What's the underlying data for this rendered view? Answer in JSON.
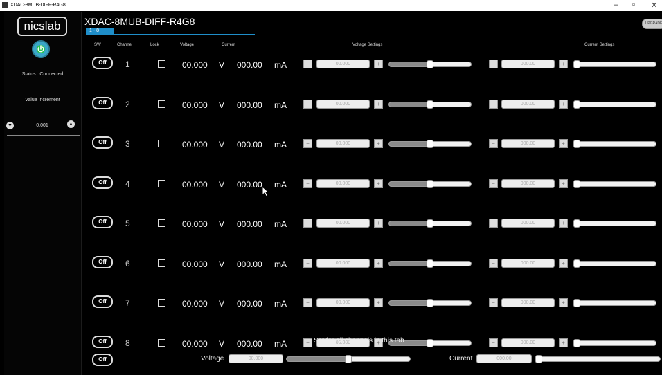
{
  "window": {
    "title": "XDAC-8MUB-DIFF-R4G8",
    "minimize": "–",
    "maximize": "▫",
    "close": "✕"
  },
  "sidebar": {
    "logo": "nicslab",
    "status": "Status : Connected",
    "value_increment_label": "Value Increment",
    "value_increment": "0.001"
  },
  "header": {
    "device_title": "XDAC-8MUB-DIFF-R4G8",
    "tab": "1 - 8",
    "upgrade": "UPGRADE",
    "columns": {
      "sw": "SW",
      "channel": "Channel",
      "lock": "Lock",
      "voltage": "Voltage",
      "current": "Current",
      "voltage_settings": "Voltage Settings",
      "current_settings": "Current Settings"
    }
  },
  "channels": [
    {
      "sw": "Off",
      "channel": "1",
      "voltage": "00.000",
      "voltage_unit": "V",
      "current": "000.00",
      "current_unit": "mA",
      "voltage_set": "00.000",
      "current_set": "000.00"
    },
    {
      "sw": "Off",
      "channel": "2",
      "voltage": "00.000",
      "voltage_unit": "V",
      "current": "000.00",
      "current_unit": "mA",
      "voltage_set": "00.000",
      "current_set": "000.00"
    },
    {
      "sw": "Off",
      "channel": "3",
      "voltage": "00.000",
      "voltage_unit": "V",
      "current": "000.00",
      "current_unit": "mA",
      "voltage_set": "00.000",
      "current_set": "000.00"
    },
    {
      "sw": "Off",
      "channel": "4",
      "voltage": "00.000",
      "voltage_unit": "V",
      "current": "000.00",
      "current_unit": "mA",
      "voltage_set": "00.000",
      "current_set": "000.00"
    },
    {
      "sw": "Off",
      "channel": "5",
      "voltage": "00.000",
      "voltage_unit": "V",
      "current": "000.00",
      "current_unit": "mA",
      "voltage_set": "00.000",
      "current_set": "000.00"
    },
    {
      "sw": "Off",
      "channel": "6",
      "voltage": "00.000",
      "voltage_unit": "V",
      "current": "000.00",
      "current_unit": "mA",
      "voltage_set": "00.000",
      "current_set": "000.00"
    },
    {
      "sw": "Off",
      "channel": "7",
      "voltage": "00.000",
      "voltage_unit": "V",
      "current": "000.00",
      "current_unit": "mA",
      "voltage_set": "00.000",
      "current_set": "000.00"
    },
    {
      "sw": "Off",
      "channel": "8",
      "voltage": "00.000",
      "voltage_unit": "V",
      "current": "000.00",
      "current_unit": "mA",
      "voltage_set": "00.000",
      "current_set": "000.00"
    }
  ],
  "sliders": {
    "voltage_level": 0.5,
    "current_level": 0.0
  },
  "all_channels": {
    "heading": "Set for all channels in this tab",
    "sw": "Off",
    "voltage_label": "Voltage",
    "voltage_value": "00.000",
    "current_label": "Current",
    "current_value": "000.00"
  },
  "icons": {
    "power": "power-icon",
    "down": "down-arrow-icon",
    "up": "up-arrow-icon",
    "minus": "−",
    "plus": "+"
  }
}
